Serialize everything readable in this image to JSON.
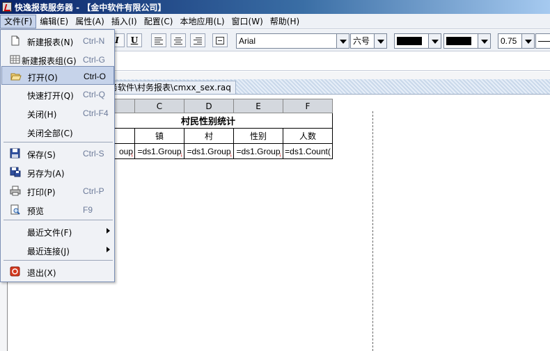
{
  "window": {
    "title": "快逸报表服务器 - 【金中软件有限公司】"
  },
  "menubar": {
    "items": [
      {
        "label": "文件(F)"
      },
      {
        "label": "编辑(E)"
      },
      {
        "label": "属性(A)"
      },
      {
        "label": "插入(I)"
      },
      {
        "label": "配置(C)"
      },
      {
        "label": "本地应用(L)"
      },
      {
        "label": "窗口(W)"
      },
      {
        "label": "帮助(H)"
      }
    ]
  },
  "toolbar": {
    "italic_label": "I",
    "underline_label": "U",
    "font_family": "Arial",
    "font_size": "六号",
    "fore_color": "#000000",
    "back_color": "#000000",
    "line_width": "0.75"
  },
  "tab": {
    "path": "务软件\\村务报表\\cmxx_sex.raq"
  },
  "sheet": {
    "column_headers": [
      "C",
      "D",
      "E",
      "F"
    ],
    "title": "村民性别统计",
    "header_row": [
      "",
      "镇",
      "村",
      "性别",
      "人数"
    ],
    "formula_row": [
      "oup",
      "=ds1.Group",
      "=ds1.Group",
      "=ds1.Group",
      "=ds1.Count("
    ]
  },
  "file_menu": {
    "items": [
      {
        "label": "新建报表(N)",
        "shortcut": "Ctrl-N",
        "icon": "new-doc-icon"
      },
      {
        "label": "新建报表组(G)",
        "shortcut": "Ctrl-G",
        "icon": "report-group-icon"
      },
      {
        "label": "打开(O)",
        "shortcut": "Ctrl-O",
        "icon": "open-folder-icon"
      },
      {
        "label": "快速打开(Q)",
        "shortcut": "Ctrl-Q"
      },
      {
        "label": "关闭(H)",
        "shortcut": "Ctrl-F4"
      },
      {
        "label": "关闭全部(C)",
        "shortcut": ""
      },
      {
        "label": "保存(S)",
        "shortcut": "Ctrl-S",
        "icon": "save-icon"
      },
      {
        "label": "另存为(A)",
        "shortcut": "",
        "icon": "save-as-icon"
      },
      {
        "label": "打印(P)",
        "shortcut": "Ctrl-P",
        "icon": "printer-icon"
      },
      {
        "label": "预览",
        "shortcut": "F9",
        "icon": "preview-icon"
      },
      {
        "label": "最近文件(F)",
        "submenu": true
      },
      {
        "label": "最近连接(J)",
        "submenu": true
      },
      {
        "label": "退出(X)",
        "shortcut": "",
        "icon": "exit-icon"
      }
    ],
    "highlighted_index": 2
  }
}
